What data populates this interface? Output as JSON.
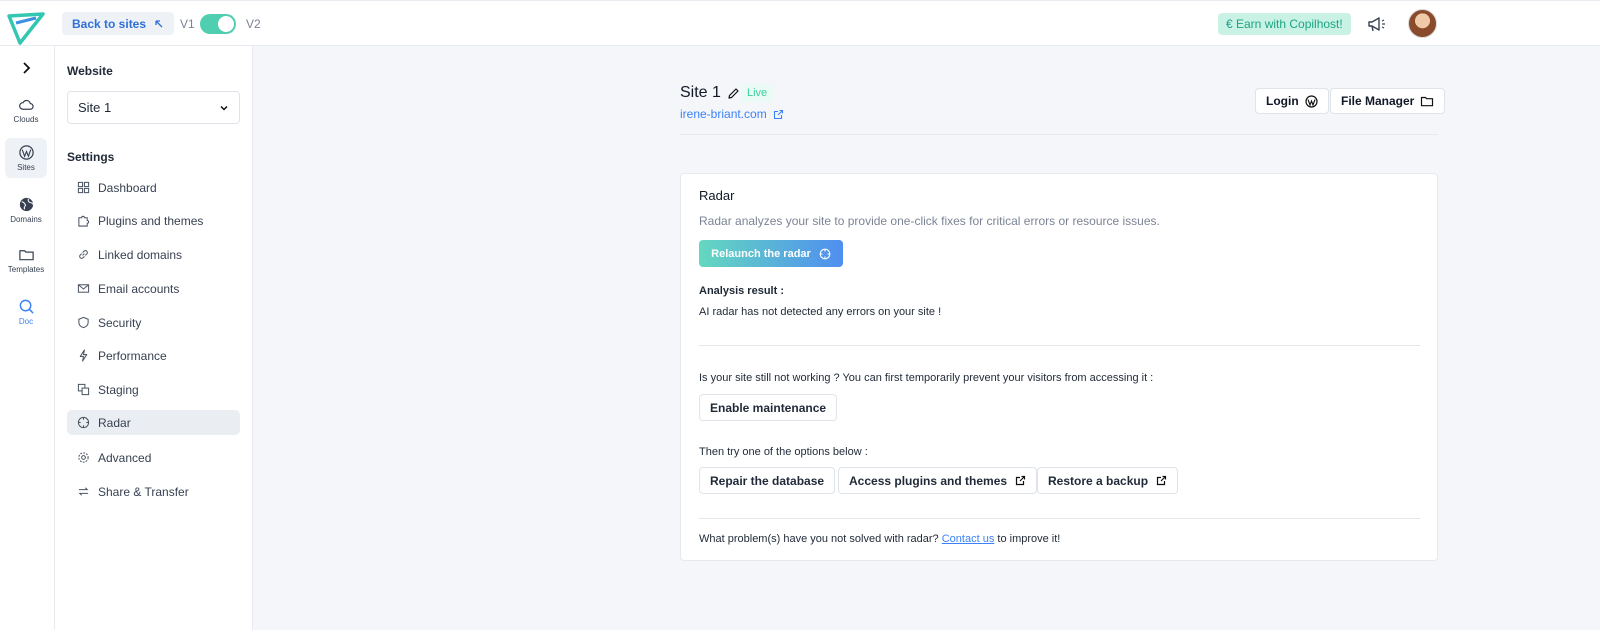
{
  "topbar": {
    "back_label": "Back to sites",
    "v1_label": "V1",
    "v2_label": "V2",
    "earn_label": "€ Earn with Copilhost!"
  },
  "rail": {
    "items": [
      {
        "label": "Clouds",
        "icon": "cloud-icon"
      },
      {
        "label": "Sites",
        "icon": "wordpress-icon"
      },
      {
        "label": "Domains",
        "icon": "globe-icon"
      },
      {
        "label": "Templates",
        "icon": "folder-icon"
      },
      {
        "label": "Doc",
        "icon": "search-icon"
      }
    ]
  },
  "sidebar": {
    "website_heading": "Website",
    "site_select_value": "Site 1",
    "settings_heading": "Settings",
    "items": [
      {
        "label": "Dashboard",
        "icon": "dashboard-icon"
      },
      {
        "label": "Plugins and themes",
        "icon": "puzzle-icon"
      },
      {
        "label": "Linked domains",
        "icon": "link-icon"
      },
      {
        "label": "Email accounts",
        "icon": "mail-icon"
      },
      {
        "label": "Security",
        "icon": "shield-icon"
      },
      {
        "label": "Performance",
        "icon": "bolt-icon"
      },
      {
        "label": "Staging",
        "icon": "copy-icon"
      },
      {
        "label": "Radar",
        "icon": "radar-icon"
      },
      {
        "label": "Advanced",
        "icon": "gear-icon"
      },
      {
        "label": "Share & Transfer",
        "icon": "transfer-icon"
      }
    ]
  },
  "site": {
    "name": "Site 1",
    "status": "Live",
    "url": "irene-briant.com",
    "login_label": "Login",
    "file_manager_label": "File Manager"
  },
  "radar": {
    "title": "Radar",
    "description": "Radar analyzes your site to provide one-click fixes for critical errors or resource issues.",
    "relaunch_label": "Relaunch the radar",
    "result_heading": "Analysis result :",
    "result_text": "AI radar has not detected any errors on your site !",
    "question_text": "Is your site still not working ? You can first temporarily prevent your visitors from accessing it :",
    "maintenance_label": "Enable maintenance",
    "options_text": "Then try one of the options below :",
    "repair_label": "Repair the database",
    "access_plugins_label": "Access plugins and themes",
    "restore_label": "Restore a backup",
    "footer_prefix": "What problem(s) have you not solved with radar?",
    "footer_link": "Contact us",
    "footer_suffix": "to improve it!"
  },
  "colors": {
    "accent_blue": "#3b82f6",
    "accent_green": "#4fcfb0",
    "live_green": "#3ccf9c"
  }
}
